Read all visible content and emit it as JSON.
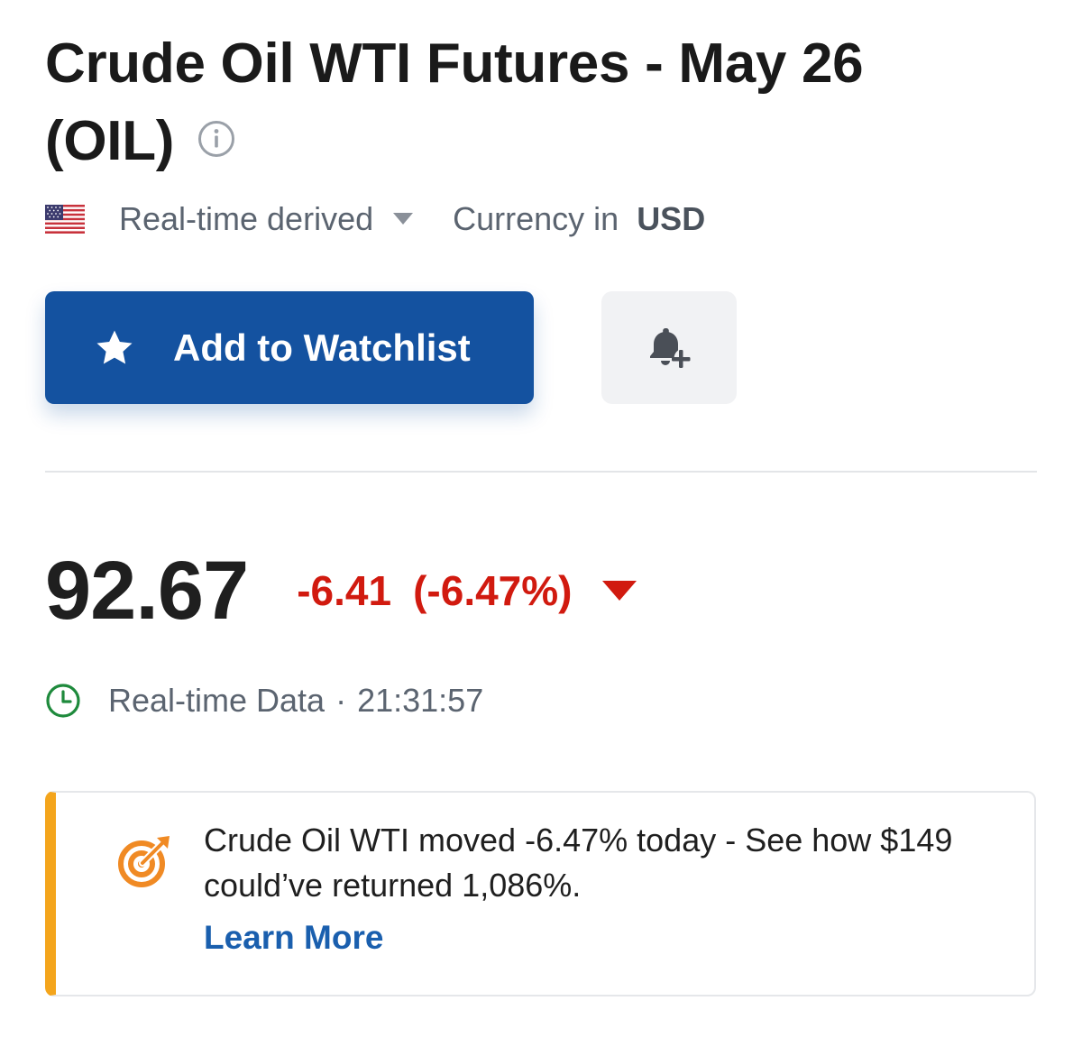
{
  "header": {
    "title": "Crude Oil WTI Futures - May 26 (OIL)",
    "info_icon": "info-circle-icon"
  },
  "meta": {
    "flag_icon": "us-flag-icon",
    "source_label": "Real-time derived",
    "currency_prefix": "Currency in",
    "currency_code": "USD"
  },
  "actions": {
    "watchlist_label": "Add to Watchlist",
    "watchlist_icon": "star-icon",
    "alert_icon": "bell-plus-icon"
  },
  "quote": {
    "price": "92.67",
    "change": "-6.41",
    "change_percent": "(-6.47%)",
    "direction": "down",
    "status_label": "Real-time Data",
    "separator": "·",
    "time": "21:31:57"
  },
  "promo": {
    "icon": "target-icon",
    "message": "Crude Oil WTI moved -6.47% today - See how $149 could’ve returned 1,086%.",
    "link_label": "Learn More"
  },
  "colors": {
    "primary": "#1452a0",
    "negative": "#d11a0f",
    "accent": "#f4a51c",
    "clock": "#1e8a3c",
    "link": "#1a5fae"
  }
}
